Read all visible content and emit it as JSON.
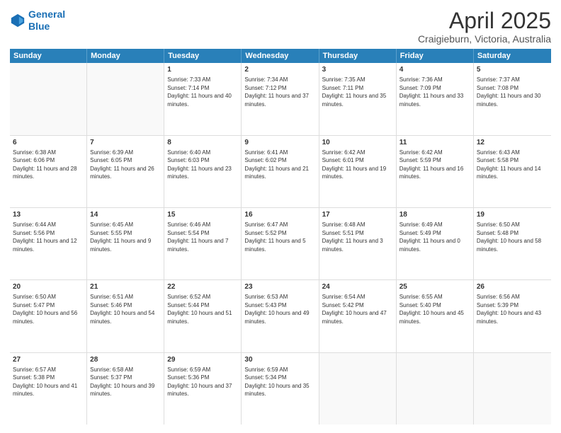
{
  "logo": {
    "line1": "General",
    "line2": "Blue"
  },
  "title": "April 2025",
  "subtitle": "Craigieburn, Victoria, Australia",
  "header_days": [
    "Sunday",
    "Monday",
    "Tuesday",
    "Wednesday",
    "Thursday",
    "Friday",
    "Saturday"
  ],
  "weeks": [
    [
      {
        "day": "",
        "info": ""
      },
      {
        "day": "",
        "info": ""
      },
      {
        "day": "1",
        "info": "Sunrise: 7:33 AM\nSunset: 7:14 PM\nDaylight: 11 hours and 40 minutes."
      },
      {
        "day": "2",
        "info": "Sunrise: 7:34 AM\nSunset: 7:12 PM\nDaylight: 11 hours and 37 minutes."
      },
      {
        "day": "3",
        "info": "Sunrise: 7:35 AM\nSunset: 7:11 PM\nDaylight: 11 hours and 35 minutes."
      },
      {
        "day": "4",
        "info": "Sunrise: 7:36 AM\nSunset: 7:09 PM\nDaylight: 11 hours and 33 minutes."
      },
      {
        "day": "5",
        "info": "Sunrise: 7:37 AM\nSunset: 7:08 PM\nDaylight: 11 hours and 30 minutes."
      }
    ],
    [
      {
        "day": "6",
        "info": "Sunrise: 6:38 AM\nSunset: 6:06 PM\nDaylight: 11 hours and 28 minutes."
      },
      {
        "day": "7",
        "info": "Sunrise: 6:39 AM\nSunset: 6:05 PM\nDaylight: 11 hours and 26 minutes."
      },
      {
        "day": "8",
        "info": "Sunrise: 6:40 AM\nSunset: 6:03 PM\nDaylight: 11 hours and 23 minutes."
      },
      {
        "day": "9",
        "info": "Sunrise: 6:41 AM\nSunset: 6:02 PM\nDaylight: 11 hours and 21 minutes."
      },
      {
        "day": "10",
        "info": "Sunrise: 6:42 AM\nSunset: 6:01 PM\nDaylight: 11 hours and 19 minutes."
      },
      {
        "day": "11",
        "info": "Sunrise: 6:42 AM\nSunset: 5:59 PM\nDaylight: 11 hours and 16 minutes."
      },
      {
        "day": "12",
        "info": "Sunrise: 6:43 AM\nSunset: 5:58 PM\nDaylight: 11 hours and 14 minutes."
      }
    ],
    [
      {
        "day": "13",
        "info": "Sunrise: 6:44 AM\nSunset: 5:56 PM\nDaylight: 11 hours and 12 minutes."
      },
      {
        "day": "14",
        "info": "Sunrise: 6:45 AM\nSunset: 5:55 PM\nDaylight: 11 hours and 9 minutes."
      },
      {
        "day": "15",
        "info": "Sunrise: 6:46 AM\nSunset: 5:54 PM\nDaylight: 11 hours and 7 minutes."
      },
      {
        "day": "16",
        "info": "Sunrise: 6:47 AM\nSunset: 5:52 PM\nDaylight: 11 hours and 5 minutes."
      },
      {
        "day": "17",
        "info": "Sunrise: 6:48 AM\nSunset: 5:51 PM\nDaylight: 11 hours and 3 minutes."
      },
      {
        "day": "18",
        "info": "Sunrise: 6:49 AM\nSunset: 5:49 PM\nDaylight: 11 hours and 0 minutes."
      },
      {
        "day": "19",
        "info": "Sunrise: 6:50 AM\nSunset: 5:48 PM\nDaylight: 10 hours and 58 minutes."
      }
    ],
    [
      {
        "day": "20",
        "info": "Sunrise: 6:50 AM\nSunset: 5:47 PM\nDaylight: 10 hours and 56 minutes."
      },
      {
        "day": "21",
        "info": "Sunrise: 6:51 AM\nSunset: 5:46 PM\nDaylight: 10 hours and 54 minutes."
      },
      {
        "day": "22",
        "info": "Sunrise: 6:52 AM\nSunset: 5:44 PM\nDaylight: 10 hours and 51 minutes."
      },
      {
        "day": "23",
        "info": "Sunrise: 6:53 AM\nSunset: 5:43 PM\nDaylight: 10 hours and 49 minutes."
      },
      {
        "day": "24",
        "info": "Sunrise: 6:54 AM\nSunset: 5:42 PM\nDaylight: 10 hours and 47 minutes."
      },
      {
        "day": "25",
        "info": "Sunrise: 6:55 AM\nSunset: 5:40 PM\nDaylight: 10 hours and 45 minutes."
      },
      {
        "day": "26",
        "info": "Sunrise: 6:56 AM\nSunset: 5:39 PM\nDaylight: 10 hours and 43 minutes."
      }
    ],
    [
      {
        "day": "27",
        "info": "Sunrise: 6:57 AM\nSunset: 5:38 PM\nDaylight: 10 hours and 41 minutes."
      },
      {
        "day": "28",
        "info": "Sunrise: 6:58 AM\nSunset: 5:37 PM\nDaylight: 10 hours and 39 minutes."
      },
      {
        "day": "29",
        "info": "Sunrise: 6:59 AM\nSunset: 5:36 PM\nDaylight: 10 hours and 37 minutes."
      },
      {
        "day": "30",
        "info": "Sunrise: 6:59 AM\nSunset: 5:34 PM\nDaylight: 10 hours and 35 minutes."
      },
      {
        "day": "",
        "info": ""
      },
      {
        "day": "",
        "info": ""
      },
      {
        "day": "",
        "info": ""
      }
    ]
  ]
}
